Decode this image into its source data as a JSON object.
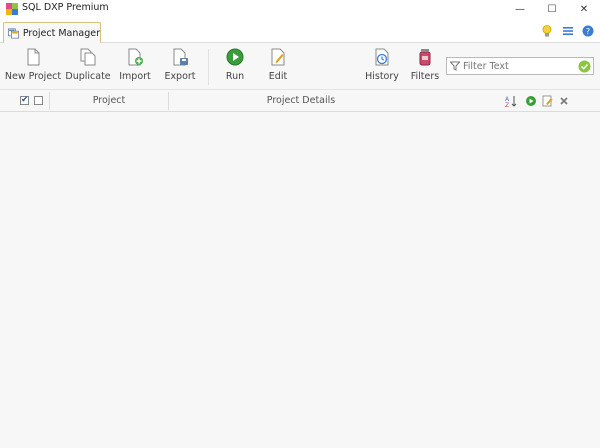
{
  "window": {
    "title": "SQL DXP Premium",
    "minimize_label": "—",
    "maximize_label": "☐",
    "close_label": "✕"
  },
  "tabs": [
    {
      "label": "Project Manager",
      "active": true
    }
  ],
  "toolbar": {
    "new_project": "New Project",
    "duplicate": "Duplicate",
    "import": "Import",
    "export": "Export",
    "run": "Run",
    "edit": "Edit",
    "history": "History",
    "filters": "Filters"
  },
  "filter": {
    "placeholder": "Filter Text",
    "value": ""
  },
  "columns": {
    "project": "Project",
    "details": "Project Details"
  },
  "colors": {
    "accent": "#d6c27a",
    "run_green": "#3a9d3a",
    "help_blue": "#3a7bd5"
  }
}
